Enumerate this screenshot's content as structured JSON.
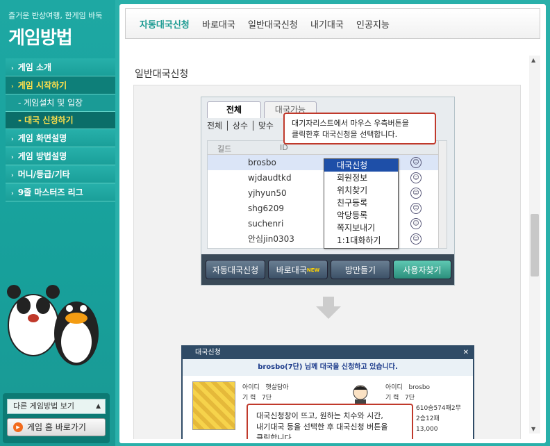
{
  "sidebar": {
    "tagline": "즐거운 반상여행, 한게임 바둑",
    "title": "게임방법",
    "menu": [
      {
        "label": "게임 소개"
      },
      {
        "label": "게임 시작하기"
      },
      {
        "label": "게임설치 및 입장"
      },
      {
        "label": "대국 신청하기"
      },
      {
        "label": "게임 화면설명"
      },
      {
        "label": "게임 방법설명"
      },
      {
        "label": "머니/등급/기타"
      },
      {
        "label": "9줄 마스터즈 리그"
      }
    ],
    "other_games": "다른 게임방법 보기",
    "home_button": "게임 홈 바로가기"
  },
  "tabs": [
    "자동대국신청",
    "바로대국",
    "일반대국신청",
    "내기대국",
    "인공지능"
  ],
  "section_title": "일반대국신청",
  "screen1": {
    "tab_all": "전체",
    "tab_available": "대국가능",
    "filters": "전체 │ 상수 │ 맞수",
    "col_guild": "길드",
    "col_id": "ID",
    "rows": [
      "brosbo",
      "wjdaudtkd",
      "yjhyun50",
      "shg6209",
      "suchenri",
      "안심jin0303"
    ],
    "context_menu": [
      "대국신청",
      "회원정보",
      "위치찾기",
      "친구등록",
      "악당등록",
      "쪽지보내기",
      "1:1대화하기"
    ],
    "callout_line1": "대기자리스트에서 마우스 우측버튼을",
    "callout_line2": "클릭한후 대국신청을 선택합니다.",
    "buttons": [
      "자동대국신청",
      "바로대국",
      "방만들기",
      "사용자찾기"
    ],
    "new_badge": "NEW"
  },
  "screen2": {
    "title": "대국신청",
    "message": "brosbo(7단) 님께 대국을 신청하고 있습니다.",
    "left_info": [
      [
        "아이디",
        "햇살담아"
      ],
      [
        "기 력",
        "7단"
      ]
    ],
    "right_info": [
      [
        "아이디",
        "brosbo"
      ],
      [
        "기 력",
        "7단"
      ],
      [
        "",
        "610승574패2무"
      ],
      [
        "",
        "2승12패"
      ],
      [
        "",
        "13,000"
      ]
    ],
    "callout_line1": "대국신청창이 뜨고, 원하는 치수와 시간,",
    "callout_line2": "내기대국 등을 선택한 후 대국신청 버튼을",
    "callout_line3": "클릭합니다."
  }
}
